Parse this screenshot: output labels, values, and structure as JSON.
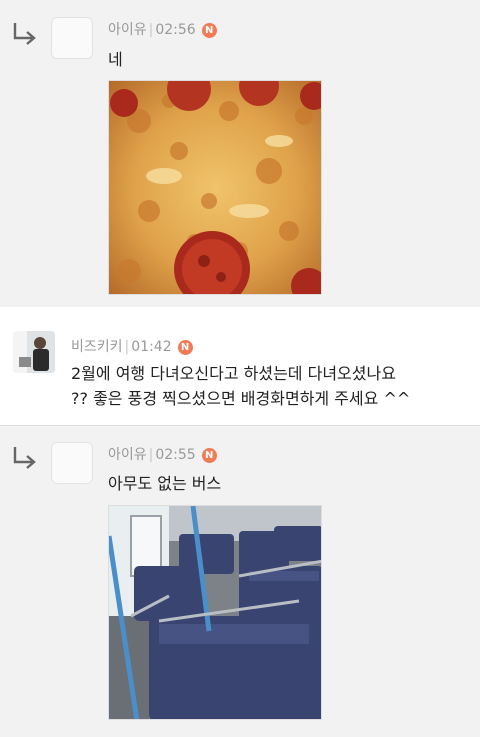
{
  "comments": [
    {
      "author": "아이유",
      "time": "02:56",
      "badge": "N",
      "text": "네",
      "photo_icon": "pizza-photo"
    },
    {
      "author": "비즈키키",
      "time": "01:42",
      "badge": "N",
      "text_line1": "2월에 여행 다녀오신다고 하셨는데 다녀오셨나요",
      "text_line2": "?? 좋은 풍경 찍으셨으면 배경화면하게 주세요 ^^"
    },
    {
      "author": "아이유",
      "time": "02:55",
      "badge": "N",
      "text": "아무도 없는 버스",
      "photo_icon": "bus-interior-photo"
    }
  ],
  "colors": {
    "badge": "#f07b55",
    "reply_background": "#f2f2f2",
    "meta_text": "#999999"
  }
}
